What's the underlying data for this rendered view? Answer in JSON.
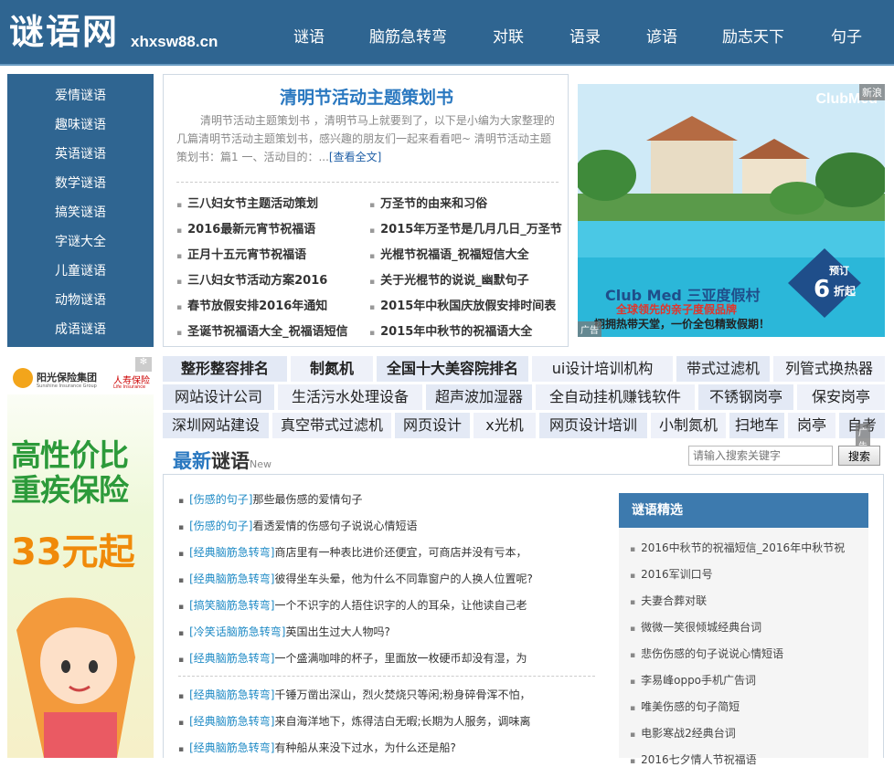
{
  "header": {
    "logo_text": "谜语网",
    "logo_domain": "xhxsw88.cn",
    "nav": [
      "谜语",
      "脑筋急转弯",
      "对联",
      "语录",
      "谚语",
      "励志天下",
      "句子"
    ]
  },
  "sidebar": {
    "items": [
      "爱情谜语",
      "趣味谜语",
      "英语谜语",
      "数学谜语",
      "搞笑谜语",
      "字谜大全",
      "儿童谜语",
      "动物谜语",
      "成语谜语"
    ]
  },
  "featured": {
    "title": "清明节活动主题策划书",
    "desc": "清明节活动主题策划书 ，清明节马上就要到了，以下是小编为大家整理的几篇清明节活动主题策划书，感兴趣的朋友们一起来看看吧~ 清明节活动主题策划书：篇1 一、活动目的：...",
    "more": "[查看全文]",
    "links_left": [
      "三八妇女节主题活动策划",
      "2016最新元宵节祝福语",
      "正月十五元宵节祝福语",
      "三八妇女节活动方案2016",
      "春节放假安排2016年通知",
      "圣诞节祝福语大全_祝福语短信"
    ],
    "links_right": [
      "万圣节的由来和习俗",
      "2015年万圣节是几月几日_万圣节",
      "光棍节祝福语_祝福短信大全",
      "关于光棍节的说说_幽默句子",
      "2015年中秋国庆放假安排时间表",
      "2015年中秋节的祝福语大全"
    ]
  },
  "ad_resort": {
    "corner": "新浪",
    "brand": "ClubMed",
    "title": "Club Med 三亚度假村",
    "subtitle": "全球领先的亲子度假品牌",
    "slogan": "栩拥热带天堂，一价全包精致假期！",
    "badge_top": "预订",
    "badge_num": "6",
    "badge_unit": "折起",
    "tag": "广告"
  },
  "ad_insurance": {
    "brand": "阳光保险集团",
    "brand_en": "Sunshine Insurance Group",
    "sub": "人寿保险",
    "sub_en": "Life Insurance",
    "line1": "高性价比",
    "line2": "重疾保险",
    "price": "33元起"
  },
  "keywords": {
    "row1": [
      "整形整容排名",
      "制氮机",
      "全国十大美容院排名",
      "ui设计培训机构",
      "带式过滤机",
      "列管式换热器"
    ],
    "row2": [
      "网站设计公司",
      "生活污水处理设备",
      "超声波加湿器",
      "全自动挂机赚钱软件",
      "不锈钢岗亭",
      "保安岗亭"
    ],
    "row3": [
      "深圳网站建设",
      "真空带式过滤机",
      "网页设计",
      "x光机",
      "网页设计培训",
      "小制氮机",
      "扫地车",
      "岗亭",
      "自考"
    ],
    "ad_tag": "广告"
  },
  "latest": {
    "title_a": "最新",
    "title_b": "谜语",
    "title_new": "New",
    "search_placeholder": "请输入搜索关键字",
    "search_button": "搜索",
    "items": [
      {
        "cat": "[伤感的句子]",
        "text": "那些最伤感的爱情句子"
      },
      {
        "cat": "[伤感的句子]",
        "text": "看透爱情的伤感句子说说心情短语"
      },
      {
        "cat": "[经典脑筋急转弯]",
        "text": "商店里有一种表比进价还便宜，可商店并没有亏本，"
      },
      {
        "cat": "[经典脑筋急转弯]",
        "text": "彼得坐车头晕，他为什么不同靠窗户的人换人位置呢?"
      },
      {
        "cat": "[搞笑脑筋急转弯]",
        "text": "一个不识字的人捂住识字的人的耳朵，让他读自己老"
      },
      {
        "cat": "[冷笑话脑筋急转弯]",
        "text": "英国出生过大人物吗?"
      },
      {
        "cat": "[经典脑筋急转弯]",
        "text": "一个盛满咖啡的杯子，里面放一枚硬币却没有湿，为"
      },
      {
        "cat": "[经典脑筋急转弯]",
        "text": "千锤万凿出深山，烈火焚烧只等闲;粉身碎骨浑不怕，"
      },
      {
        "cat": "[经典脑筋急转弯]",
        "text": "来自海洋地下，炼得洁白无暇;长期为人服务，调味离"
      },
      {
        "cat": "[经典脑筋急转弯]",
        "text": "有种船从来没下过水，为什么还是船?"
      }
    ]
  },
  "picks": {
    "title": "谜语精选",
    "items": [
      "2016中秋节的祝福短信_2016年中秋节祝",
      "2016军训口号",
      "夫妻合葬对联",
      "微微一笑很倾城经典台词",
      "悲伤伤感的句子说说心情短语",
      "李易峰oppo手机广告词",
      "唯美伤感的句子简短",
      "电影寒战2经典台词",
      "2016七夕情人节祝福语"
    ]
  }
}
